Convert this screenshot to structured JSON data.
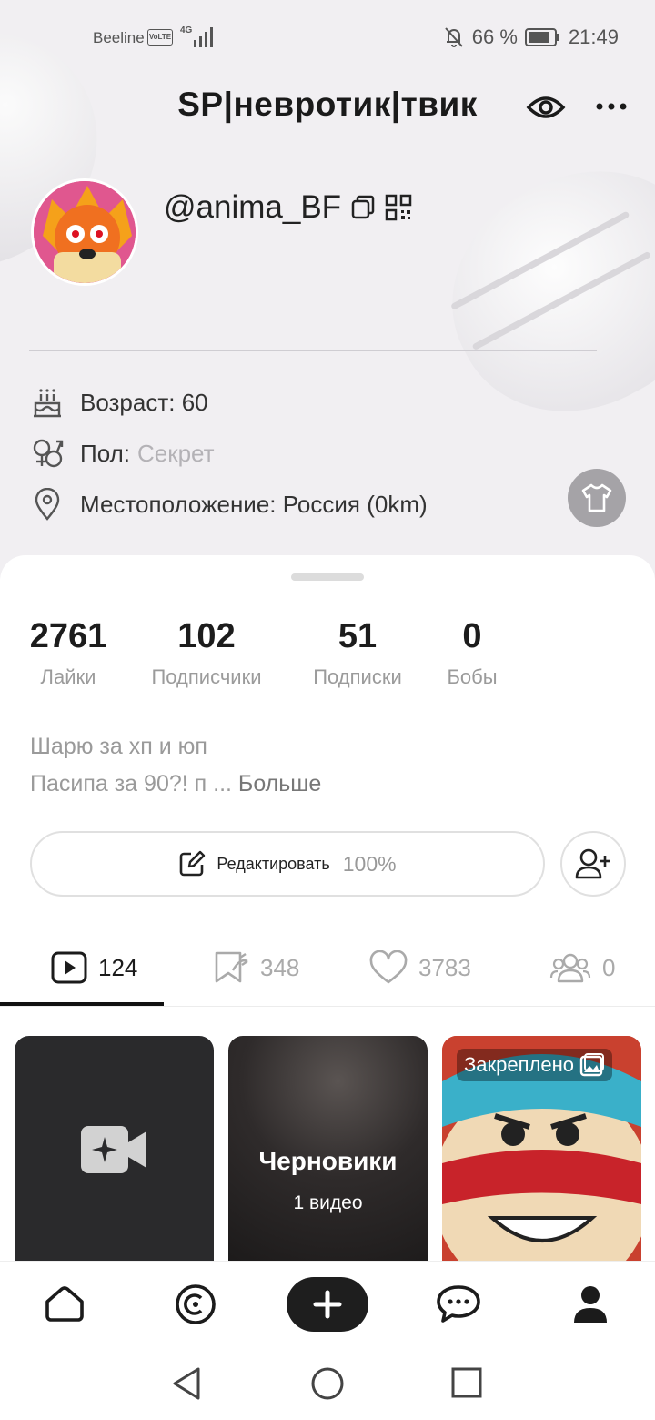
{
  "status_bar": {
    "carrier": "Beeline",
    "volte": "VoLTE",
    "network": "4G",
    "battery": "66 %",
    "time": "21:49"
  },
  "header": {
    "title": "SP|невротик|твик"
  },
  "profile": {
    "username": "@anima_BF",
    "age_label": "Возраст: 60",
    "gender_label": "Пол:",
    "gender_value": "Секрет",
    "location_label": "Местоположение: Россия (0km)"
  },
  "stats": [
    {
      "num": "2761",
      "label": "Лайки"
    },
    {
      "num": "102",
      "label": "Подписчики"
    },
    {
      "num": "51",
      "label": "Подписки"
    },
    {
      "num": "0",
      "label": "Бобы"
    }
  ],
  "bio": {
    "line1": "Шарю за хп и юп",
    "line2": "Пасипа за 90?! п ... ",
    "more": "Больше"
  },
  "edit": {
    "label": "Редактировать",
    "percent": "100%"
  },
  "tabs": [
    {
      "icon": "play-icon",
      "count": "124"
    },
    {
      "icon": "bookmark-icon",
      "count": "348"
    },
    {
      "icon": "heart-icon",
      "count": "3783"
    },
    {
      "icon": "group-icon",
      "count": "0"
    }
  ],
  "cards": {
    "drafts_title": "Черновики",
    "drafts_count": "1 видео",
    "pinned_label": "Закреплено"
  },
  "colors": {
    "background": "#f1eff2",
    "sheet": "#ffffff",
    "active": "#1b1b1b",
    "muted": "#9b9b9b"
  }
}
